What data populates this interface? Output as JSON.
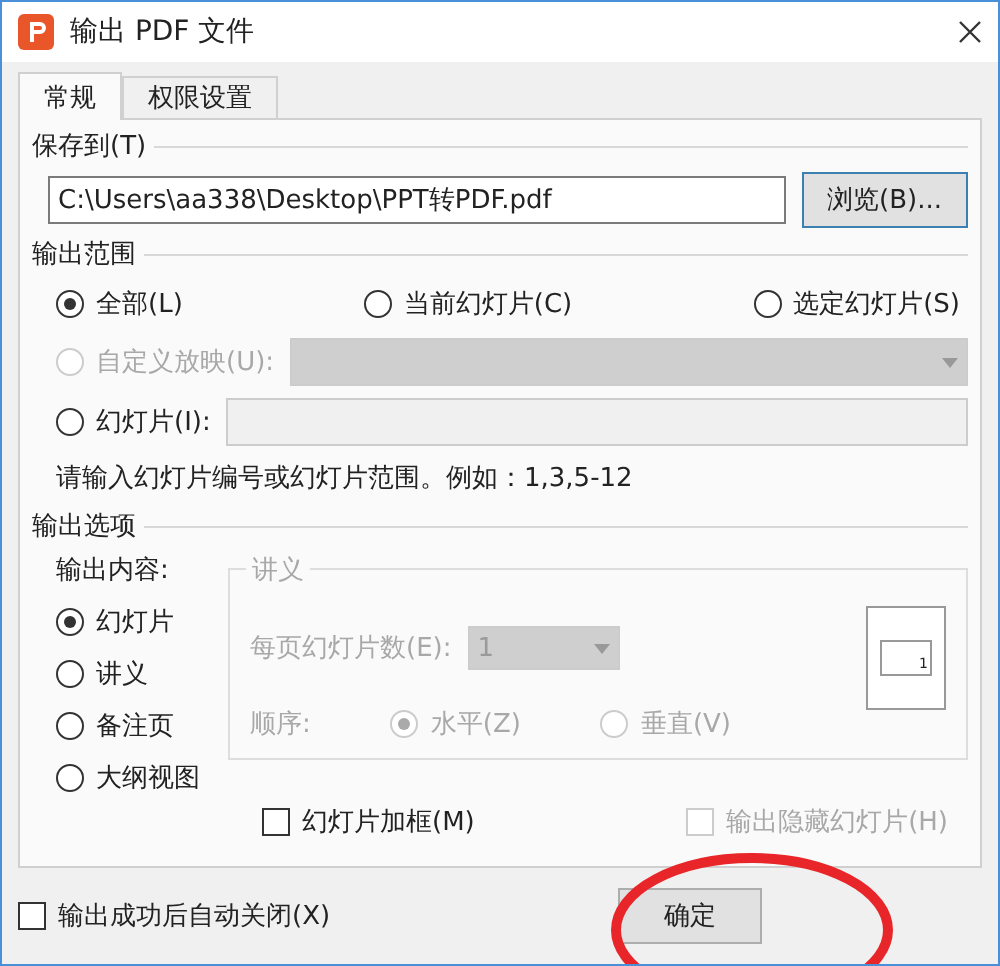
{
  "window": {
    "title": "输出 PDF 文件"
  },
  "tabs": [
    {
      "label": "常规",
      "selected": true
    },
    {
      "label": "权限设置",
      "selected": false
    }
  ],
  "save_to": {
    "label": "保存到(T)",
    "path": "C:\\Users\\aa338\\Desktop\\PPT转PDF.pdf",
    "browse": "浏览(B)..."
  },
  "range": {
    "label": "输出范围",
    "options": [
      {
        "kind": "plain",
        "label": "全部(L)",
        "selected": true,
        "disabled": false
      },
      {
        "kind": "plain",
        "label": "当前幻灯片(C)",
        "selected": false,
        "disabled": false
      },
      {
        "kind": "plain",
        "label": "选定幻灯片(S)",
        "selected": false,
        "disabled": false
      },
      {
        "kind": "dropdown",
        "label": "自定义放映(U):",
        "selected": false,
        "disabled": true
      },
      {
        "kind": "input",
        "label": "幻灯片(I):",
        "selected": false,
        "disabled": false
      }
    ],
    "hint": "请输入幻灯片编号或幻灯片范围。例如：1,3,5-12"
  },
  "options": {
    "label": "输出选项",
    "content_label": "输出内容:",
    "content": [
      {
        "label": "幻灯片",
        "selected": true
      },
      {
        "label": "讲义",
        "selected": false
      },
      {
        "label": "备注页",
        "selected": false
      },
      {
        "label": "大纲视图",
        "selected": false
      }
    ],
    "handout": {
      "label": "讲义",
      "disabled": true,
      "per_page_label": "每页幻灯片数(E):",
      "per_page_value": "1",
      "order_label": "顺序:",
      "order": [
        {
          "label": "水平(Z)",
          "selected": true
        },
        {
          "label": "垂直(V)",
          "selected": false
        }
      ],
      "preview_number": "1"
    },
    "checks": [
      {
        "label": "幻灯片加框(M)",
        "checked": false,
        "disabled": false
      },
      {
        "label": "输出隐藏幻灯片(H)",
        "checked": false,
        "disabled": true
      }
    ]
  },
  "footer": {
    "auto_close": {
      "label": "输出成功后自动关闭(X)",
      "checked": false
    },
    "ok": "确定"
  }
}
